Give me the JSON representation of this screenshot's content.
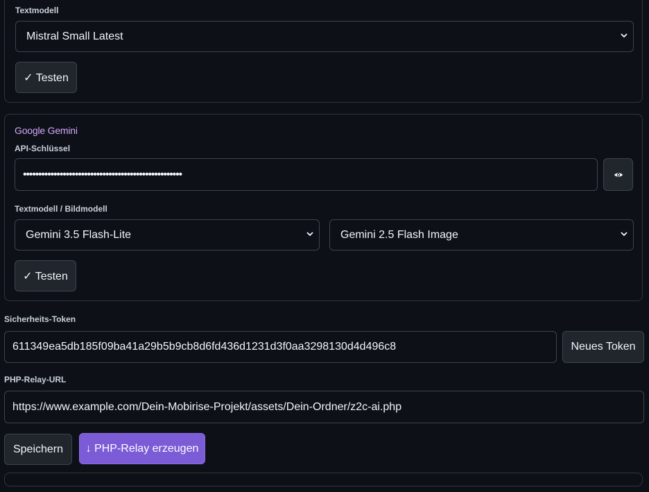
{
  "mistral": {
    "text_model_label": "Textmodell",
    "text_model_value": "Mistral Small Latest",
    "test_button": "✓ Testen"
  },
  "gemini": {
    "title": "Google Gemini",
    "api_key_label": "API-Schlüssel",
    "api_key_value": "••••••••••••••••••••••••••••••••••••••••••••••••••••",
    "model_label": "Textmodell / Bildmodell",
    "text_model_value": "Gemini 3.5 Flash-Lite",
    "image_model_value": "Gemini 2.5 Flash Image",
    "test_button": "✓ Testen"
  },
  "security": {
    "token_label": "Sicherheits-Token",
    "token_value": "611349ea5db185f09ba41a29b5b9cb8d6fd436d1231d3f0aa3298130d4d496c8",
    "new_token_button": "Neues Token"
  },
  "relay": {
    "url_label": "PHP-Relay-URL",
    "url_value": "https://www.example.com/Dein-Mobirise-Projekt/assets/Dein-Ordner/z2c-ai.php"
  },
  "actions": {
    "save_button": "Speichern",
    "generate_relay_button": "↓ PHP-Relay erzeugen"
  },
  "colors": {
    "background": "#0d1117",
    "accent": "#7b5bd6",
    "section_title": "#d2a8ff"
  }
}
